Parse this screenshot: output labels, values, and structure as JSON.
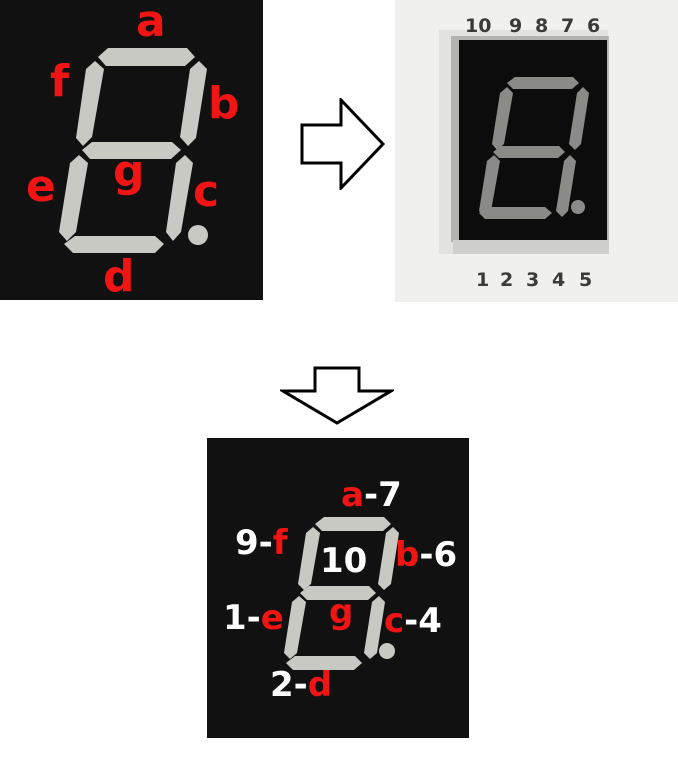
{
  "segment_labels": {
    "a": "a",
    "b": "b",
    "c": "c",
    "d": "d",
    "e": "e",
    "f": "f",
    "g": "g"
  },
  "photo": {
    "top_pins": [
      "10",
      "9",
      "8",
      "7",
      "6"
    ],
    "bottom_pins": [
      "1",
      "2",
      "3",
      "4",
      "5"
    ]
  },
  "pin_map": {
    "a": {
      "segment": "a",
      "sep": "-",
      "pin": "7"
    },
    "f": {
      "pin": "9",
      "sep": "-",
      "segment": "f"
    },
    "b": {
      "segment": "b",
      "sep": "-",
      "pin": "6"
    },
    "e": {
      "pin": "1",
      "sep": "-",
      "segment": "e"
    },
    "c": {
      "segment": "c",
      "sep": "-",
      "pin": "4"
    },
    "d": {
      "pin": "2",
      "sep": "-",
      "segment": "d"
    },
    "g": {
      "segment": "g"
    },
    "common": "10"
  },
  "colors": {
    "segment_label": "#f01414",
    "pin_label": "#ffffff",
    "segment_fill": "#c9c9c4",
    "panel_background": "#111111"
  }
}
